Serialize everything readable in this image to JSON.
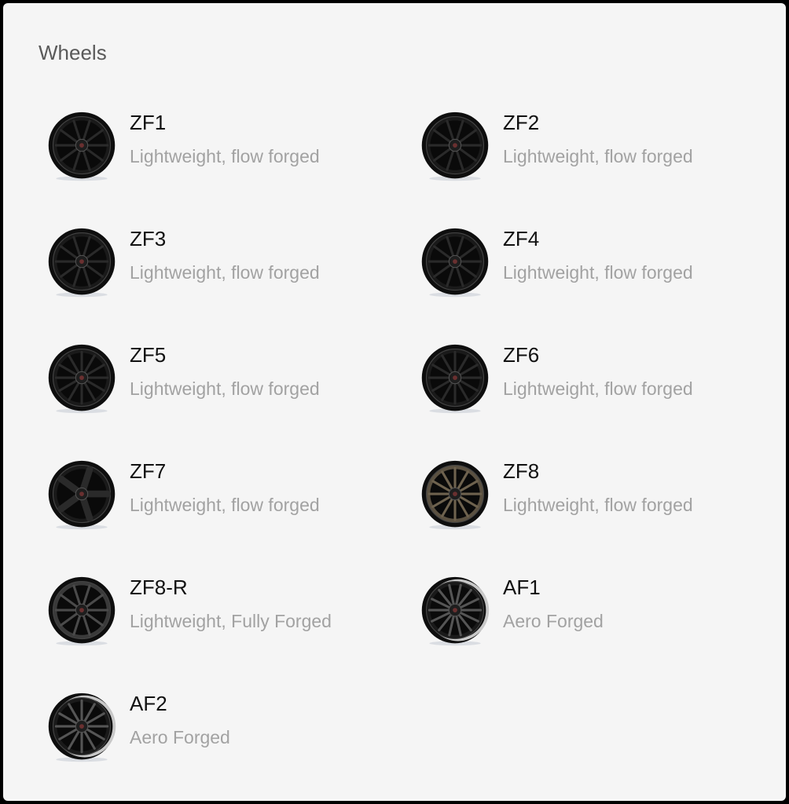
{
  "section": {
    "title": "Wheels"
  },
  "wheels": [
    {
      "name": "ZF1",
      "description": "Lightweight, flow forged",
      "icon": "wheel-icon",
      "finish": "black",
      "spokes": 10
    },
    {
      "name": "ZF2",
      "description": "Lightweight, flow forged",
      "icon": "wheel-icon",
      "finish": "black",
      "spokes": 10
    },
    {
      "name": "ZF3",
      "description": "Lightweight, flow forged",
      "icon": "wheel-icon",
      "finish": "black",
      "spokes": 10
    },
    {
      "name": "ZF4",
      "description": "Lightweight, flow forged",
      "icon": "wheel-icon",
      "finish": "black",
      "spokes": 10
    },
    {
      "name": "ZF5",
      "description": "Lightweight, flow forged",
      "icon": "wheel-icon",
      "finish": "black",
      "spokes": 12
    },
    {
      "name": "ZF6",
      "description": "Lightweight, flow forged",
      "icon": "wheel-icon",
      "finish": "black",
      "spokes": 12
    },
    {
      "name": "ZF7",
      "description": "Lightweight, flow forged",
      "icon": "wheel-icon",
      "finish": "black",
      "spokes": 5
    },
    {
      "name": "ZF8",
      "description": "Lightweight, flow forged",
      "icon": "wheel-icon",
      "finish": "bronze",
      "spokes": 12
    },
    {
      "name": "ZF8-R",
      "description": "Lightweight, Fully Forged",
      "icon": "wheel-icon",
      "finish": "gunmetal",
      "spokes": 10
    },
    {
      "name": "AF1",
      "description": "Aero Forged",
      "icon": "wheel-icon",
      "finish": "silver-lip",
      "spokes": 14
    },
    {
      "name": "AF2",
      "description": "Aero Forged",
      "icon": "wheel-icon",
      "finish": "silver-lip",
      "spokes": 12
    }
  ],
  "colors": {
    "background": "#f5f5f5",
    "title": "#5a5a5a",
    "name": "#111111",
    "description": "#a2a2a2"
  }
}
